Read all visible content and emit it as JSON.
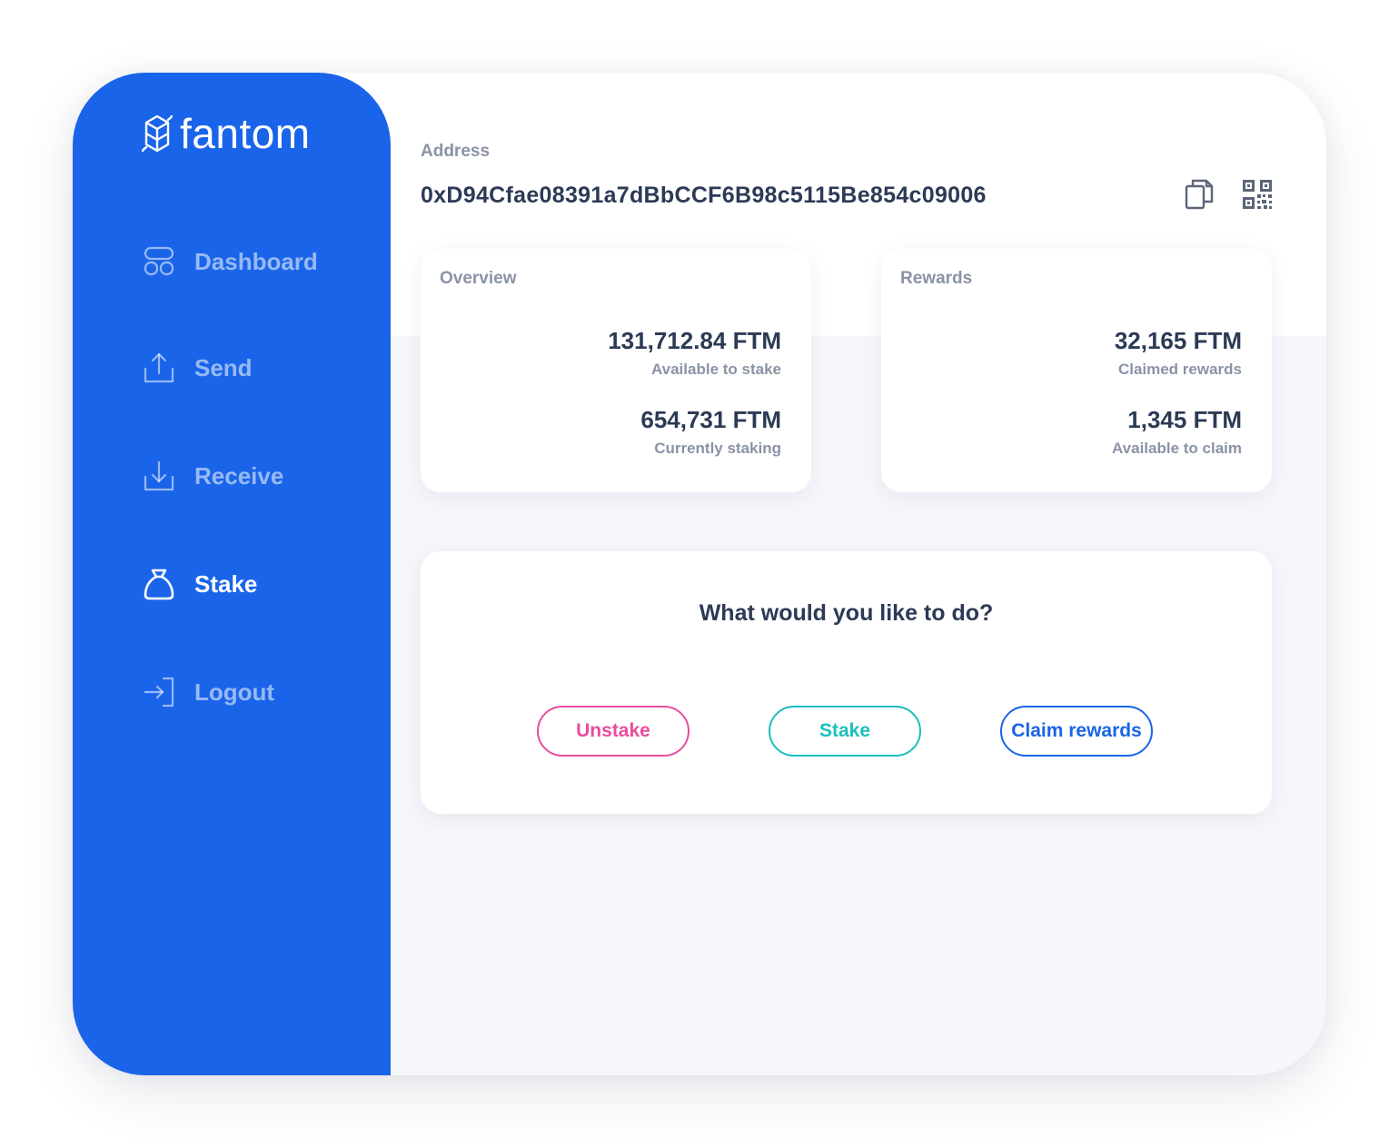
{
  "brand": {
    "name": "fantom"
  },
  "colors": {
    "sidebar": "#1a64e9",
    "unstake": "#e94c9e",
    "stake": "#19bfbd",
    "claim": "#1a64e9",
    "text_dark": "#2c3a55",
    "text_muted": "#8a93a5"
  },
  "nav": {
    "items": [
      {
        "label": "Dashboard",
        "icon": "dashboard-icon",
        "active": false
      },
      {
        "label": "Send",
        "icon": "upload-icon",
        "active": false
      },
      {
        "label": "Receive",
        "icon": "download-icon",
        "active": false
      },
      {
        "label": "Stake",
        "icon": "money-bag-icon",
        "active": true
      },
      {
        "label": "Logout",
        "icon": "logout-icon",
        "active": false
      }
    ]
  },
  "address": {
    "label": "Address",
    "value": "0xD94Cfae08391a7dBbCCF6B98c5115Be854c09006",
    "copy_icon": "copy-icon",
    "qr_icon": "qr-code-icon"
  },
  "overview": {
    "title": "Overview",
    "stats": [
      {
        "value": "131,712.84 FTM",
        "label": "Available to stake"
      },
      {
        "value": "654,731 FTM",
        "label": "Currently staking"
      }
    ]
  },
  "rewards": {
    "title": "Rewards",
    "stats": [
      {
        "value": "32,165 FTM",
        "label": "Claimed rewards"
      },
      {
        "value": "1,345 FTM",
        "label": "Available to claim"
      }
    ]
  },
  "actions": {
    "question": "What would you like to do?",
    "unstake_label": "Unstake",
    "stake_label": "Stake",
    "claim_label": "Claim rewards"
  }
}
